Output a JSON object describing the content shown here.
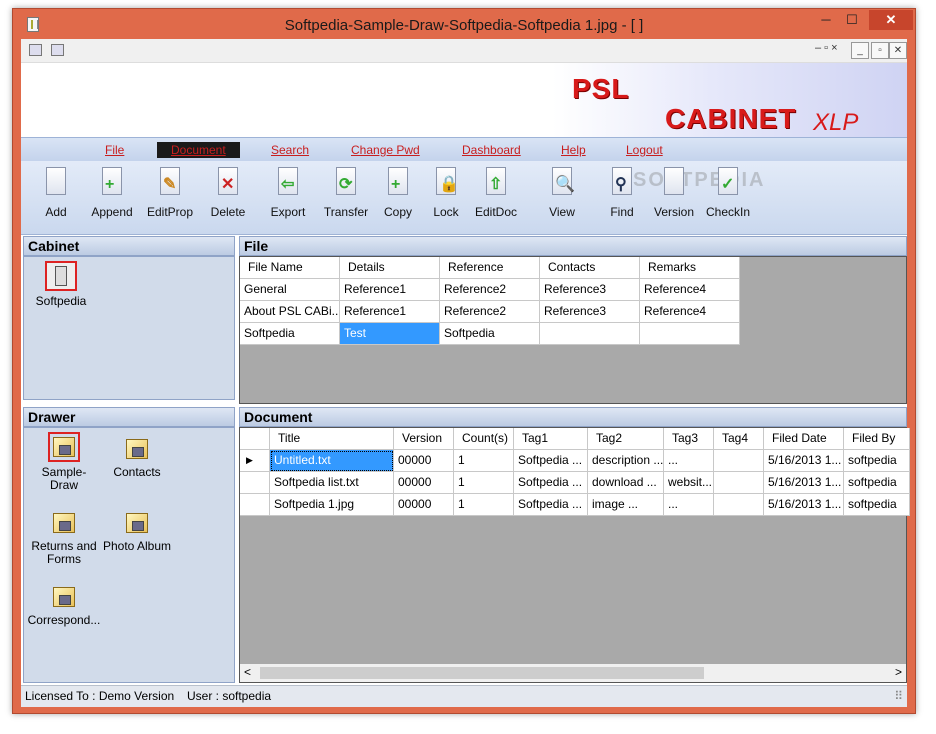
{
  "window": {
    "title": "Softpedia-Sample-Draw-Softpedia-Softpedia 1.jpg - [ ]",
    "min": "─",
    "max": "☐",
    "close": "✕"
  },
  "mdi": {
    "min": "_",
    "restore": "▫",
    "close": "✕",
    "small_controls": "‒ ▫ ×"
  },
  "banner": {
    "psl": "PSL",
    "cabinet": "CABINET",
    "xlp": "XLP"
  },
  "menu": [
    "File",
    "Document",
    "Search",
    "Change Pwd",
    "Dashboard",
    "Help",
    "Logout"
  ],
  "toolbar": [
    {
      "label": "Add",
      "icon": "add-doc-icon",
      "sym": "",
      "color": "#2a7"
    },
    {
      "label": "Append",
      "icon": "append-icon",
      "sym": "+",
      "color": "#3a3"
    },
    {
      "label": "EditProp",
      "icon": "edit-prop-icon",
      "sym": "✎",
      "color": "#c82"
    },
    {
      "label": "Delete",
      "icon": "delete-icon",
      "sym": "✕",
      "color": "#c22"
    },
    {
      "label": "Export",
      "icon": "export-icon",
      "sym": "⇦",
      "color": "#3a3"
    },
    {
      "label": "Transfer",
      "icon": "transfer-icon",
      "sym": "⟳",
      "color": "#3a3"
    },
    {
      "label": "Copy",
      "icon": "copy-icon",
      "sym": "+",
      "color": "#3a3"
    },
    {
      "label": "Lock",
      "icon": "lock-icon",
      "sym": "🔒",
      "color": "#c90"
    },
    {
      "label": "EditDoc",
      "icon": "edit-doc-icon",
      "sym": "⇧",
      "color": "#3a3"
    },
    {
      "label": "View",
      "icon": "view-icon",
      "sym": "🔍",
      "color": "#358"
    },
    {
      "label": "Find",
      "icon": "find-icon",
      "sym": "⚲",
      "color": "#235"
    },
    {
      "label": "Version",
      "icon": "version-icon",
      "sym": "",
      "color": "#358"
    },
    {
      "label": "CheckIn",
      "icon": "check-in-icon",
      "sym": "✓",
      "color": "#3a3"
    }
  ],
  "watermark": "SOFTPEDIA",
  "cabinet": {
    "header": "Cabinet",
    "items": [
      {
        "label": "Softpedia"
      }
    ]
  },
  "file": {
    "header": "File",
    "columns": [
      "File Name",
      "Details",
      "Reference",
      "Contacts",
      "Remarks"
    ],
    "rows": [
      [
        "General",
        "Reference1",
        "Reference2",
        "Reference3",
        "Reference4"
      ],
      [
        "About PSL CABi...",
        "Reference1",
        "Reference2",
        "Reference3",
        "Reference4"
      ],
      [
        "Softpedia",
        "Test",
        "Softpedia",
        "",
        ""
      ]
    ]
  },
  "drawer": {
    "header": "Drawer",
    "items": [
      {
        "label": "Sample-Draw"
      },
      {
        "label": "Contacts"
      },
      {
        "label": "Returns and Forms"
      },
      {
        "label": "Photo Album"
      },
      {
        "label": "Correspond..."
      }
    ]
  },
  "document": {
    "header": "Document",
    "columns": [
      "Title",
      "Version",
      "Count(s)",
      "Tag1",
      "Tag2",
      "Tag3",
      "Tag4",
      "Filed Date",
      "Filed By"
    ],
    "rows": [
      [
        "Untitled.txt",
        "00000",
        "1",
        "Softpedia ...",
        "description ...",
        "...",
        "",
        "5/16/2013 1...",
        "softpedia"
      ],
      [
        "Softpedia list.txt",
        "00000",
        "1",
        "Softpedia ...",
        "download ...",
        "websit...",
        "",
        "5/16/2013 1...",
        "softpedia"
      ],
      [
        "Softpedia 1.jpg",
        "00000",
        "1",
        "Softpedia ...",
        "image ...",
        "...",
        "",
        "5/16/2013 1...",
        "softpedia"
      ]
    ],
    "row_pointer": "▶",
    "scroll_left": "<",
    "scroll_right": ">"
  },
  "status": {
    "license": "Licensed To : Demo Version",
    "user": "User : softpedia",
    "grip": "⠿"
  }
}
